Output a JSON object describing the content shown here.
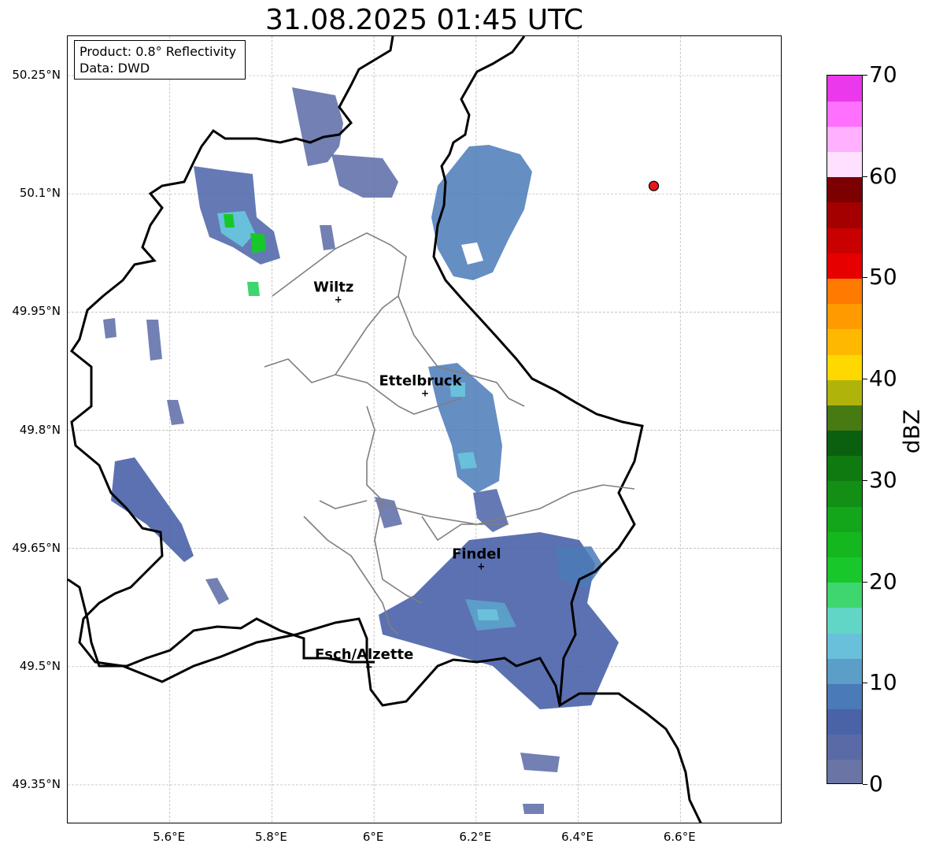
{
  "title": "31.08.2025 01:45 UTC",
  "info": {
    "product": "Product: 0.8° Reflectivity",
    "data": "Data: DWD"
  },
  "axes": {
    "lon_ticks": [
      "5.6°E",
      "5.8°E",
      "6°E",
      "6.2°E",
      "6.4°E",
      "6.6°E"
    ],
    "lat_ticks": [
      "50.25°N",
      "50.1°N",
      "49.95°N",
      "49.8°N",
      "49.65°N",
      "49.5°N",
      "49.35°N"
    ],
    "lon_range": [
      5.4,
      6.8
    ],
    "lat_range": [
      49.3,
      50.3
    ],
    "grid": true
  },
  "cities": [
    {
      "name": "Wiltz",
      "lon": 5.93,
      "lat": 49.966
    },
    {
      "name": "Ettelbruck",
      "lon": 6.1,
      "lat": 49.847
    },
    {
      "name": "Findel",
      "lon": 6.21,
      "lat": 49.627
    },
    {
      "name": "Esch/Alzette",
      "lon": 5.99,
      "lat": 49.5
    }
  ],
  "radar_site": {
    "lon": 6.548,
    "lat": 50.11,
    "color": "#e31a1c"
  },
  "colorbar": {
    "label": "dBZ",
    "min": 0,
    "max": 70,
    "tick_labels": [
      "0",
      "10",
      "20",
      "30",
      "40",
      "50",
      "60",
      "70"
    ],
    "colors": [
      "#6a75a6",
      "#5a6aa6",
      "#4a62a8",
      "#4a7ab8",
      "#5b9ec8",
      "#68c0db",
      "#62d6c6",
      "#3ed66e",
      "#18c82a",
      "#14b71e",
      "#14a61a",
      "#128f14",
      "#0f7a10",
      "#0b6010",
      "#477a12",
      "#b0b40a",
      "#ffd800",
      "#ffb800",
      "#ff9a00",
      "#ff7a00",
      "#e60000",
      "#c80000",
      "#a40000",
      "#7c0000",
      "#ffe0ff",
      "#ffb0ff",
      "#ff70ff",
      "#ec38ec"
    ]
  }
}
